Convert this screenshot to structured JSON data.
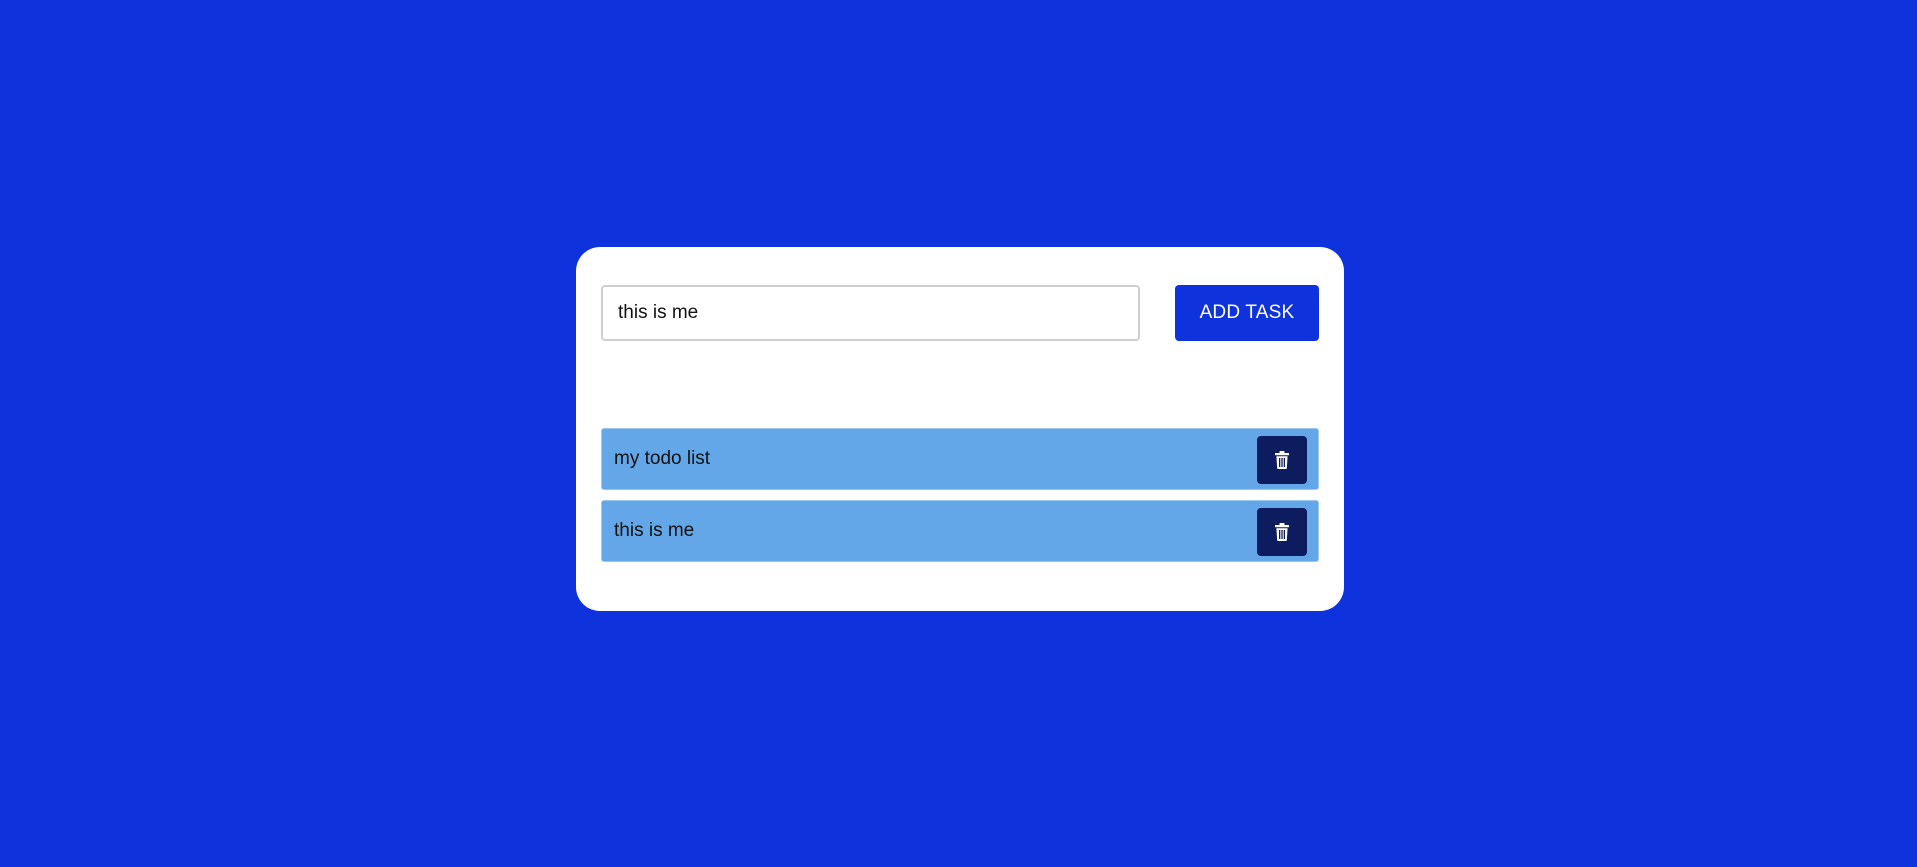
{
  "input": {
    "value": "this is me",
    "placeholder": ""
  },
  "add_button": {
    "label": "ADD TASK"
  },
  "tasks": [
    {
      "text": "my todo list",
      "delete_icon": "trash-icon"
    },
    {
      "text": "this is me",
      "delete_icon": "trash-icon"
    }
  ],
  "colors": {
    "background": "#0e33dc",
    "card": "#ffffff",
    "accent": "#0e33dc",
    "task_item": "#64a7e8",
    "delete_button": "#0c1c5e"
  }
}
